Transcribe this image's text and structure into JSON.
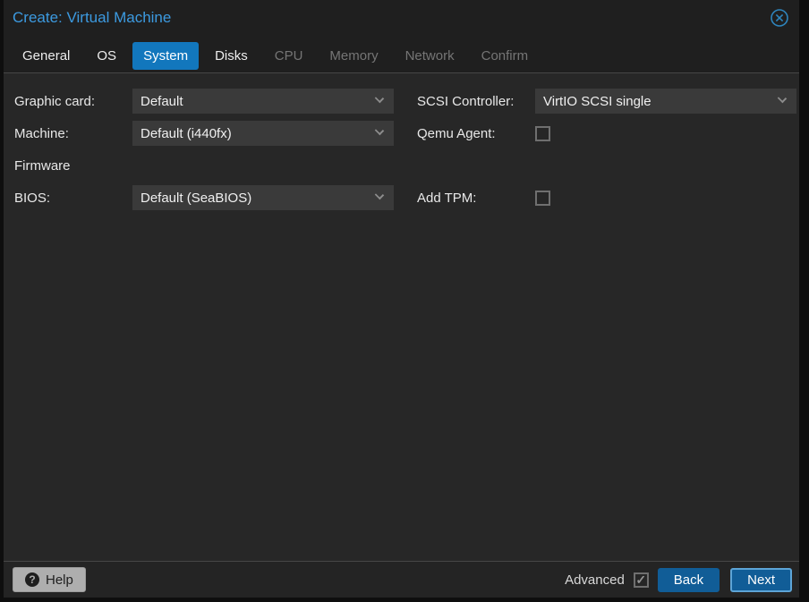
{
  "window": {
    "title": "Create: Virtual Machine"
  },
  "tabs": [
    {
      "label": "General",
      "state": "enabled"
    },
    {
      "label": "OS",
      "state": "enabled"
    },
    {
      "label": "System",
      "state": "active"
    },
    {
      "label": "Disks",
      "state": "enabled"
    },
    {
      "label": "CPU",
      "state": "disabled"
    },
    {
      "label": "Memory",
      "state": "disabled"
    },
    {
      "label": "Network",
      "state": "disabled"
    },
    {
      "label": "Confirm",
      "state": "disabled"
    }
  ],
  "form": {
    "left": {
      "graphic_card": {
        "label": "Graphic card:",
        "value": "Default"
      },
      "machine": {
        "label": "Machine:",
        "value": "Default (i440fx)"
      },
      "firmware_section": {
        "label": "Firmware"
      },
      "bios": {
        "label": "BIOS:",
        "value": "Default (SeaBIOS)"
      }
    },
    "right": {
      "scsi_controller": {
        "label": "SCSI Controller:",
        "value": "VirtIO SCSI single"
      },
      "qemu_agent": {
        "label": "Qemu Agent:",
        "checked": false
      },
      "add_tpm": {
        "label": "Add TPM:",
        "checked": false
      }
    }
  },
  "footer": {
    "help": {
      "label": "Help",
      "icon": "?"
    },
    "advanced": {
      "label": "Advanced",
      "checked": true
    },
    "back_label": "Back",
    "next_label": "Next"
  },
  "icons": {
    "check": "✓"
  },
  "colors": {
    "title_blue": "#3c9ae0",
    "active_tab_blue": "#1277bd",
    "button_blue": "#115d97",
    "next_focus_border": "#5da4d6",
    "panel_bg": "#272727",
    "field_bg": "#3a3a3a",
    "close_icon_blue": "#2e85bd"
  }
}
